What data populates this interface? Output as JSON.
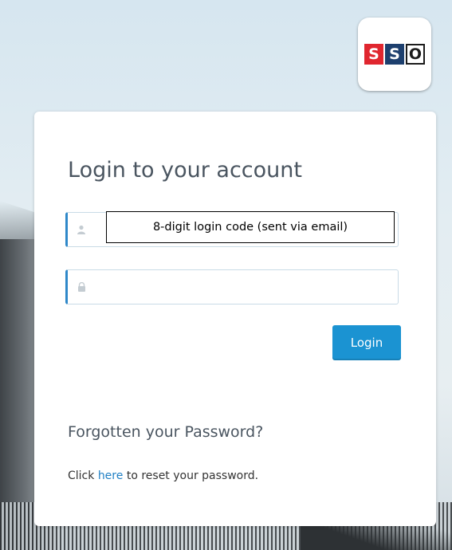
{
  "logo": {
    "letters": [
      "S",
      "S",
      "O"
    ]
  },
  "login_form": {
    "title": "Login to your account",
    "username": {
      "value": "",
      "placeholder": "",
      "icon": "user-icon"
    },
    "password": {
      "value": "",
      "placeholder": "",
      "icon": "lock-icon"
    },
    "annotation": "8-digit login code (sent via email)",
    "submit_label": "Login"
  },
  "forgot": {
    "heading": "Forgotten your Password?",
    "prefix": "Click",
    "link_text": "here",
    "suffix": "to reset your password."
  },
  "colors": {
    "accent": "#1b93d2",
    "link": "#1f7fc4",
    "logo_red": "#e0262f",
    "logo_navy": "#1d3f6e"
  }
}
